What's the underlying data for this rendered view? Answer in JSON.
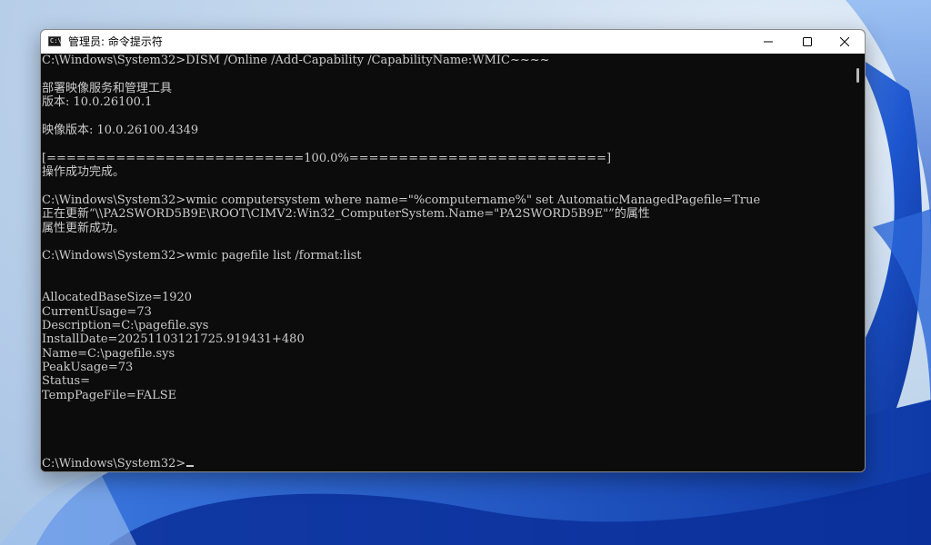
{
  "window": {
    "title": "管理员: 命令提示符",
    "icon_label": "C:\\"
  },
  "titlebar_buttons": {
    "minimize_icon": "minimize-icon",
    "maximize_icon": "maximize-icon",
    "close_icon": "close-icon"
  },
  "console": {
    "lines": [
      "C:\\Windows\\System32>DISM /Online /Add-Capability /CapabilityName:WMIC~~~~",
      "",
      "部署映像服务和管理工具",
      "版本: 10.0.26100.1",
      "",
      "映像版本: 10.0.26100.4349",
      "",
      "[==========================100.0%==========================]",
      "操作成功完成。",
      "",
      "C:\\Windows\\System32>wmic computersystem where name=\"%computername%\" set AutomaticManagedPagefile=True",
      "正在更新“\\\\PA2SWORD5B9E\\ROOT\\CIMV2:Win32_ComputerSystem.Name=\"PA2SWORD5B9E\"”的属性",
      "属性更新成功。",
      "",
      "C:\\Windows\\System32>wmic pagefile list /format:list",
      "",
      "",
      "AllocatedBaseSize=1920",
      "CurrentUsage=73",
      "Description=C:\\pagefile.sys",
      "InstallDate=20251103121725.919431+480",
      "Name=C:\\pagefile.sys",
      "PeakUsage=73",
      "Status=",
      "TempPageFile=FALSE",
      "",
      "",
      "",
      "",
      ""
    ],
    "prompt": "C:\\Windows\\System32>"
  },
  "colors": {
    "console_background": "#0c0c0c",
    "console_text": "#cccccc",
    "titlebar_background": "#ffffff",
    "wallpaper_accent": "#1e5fd6"
  }
}
